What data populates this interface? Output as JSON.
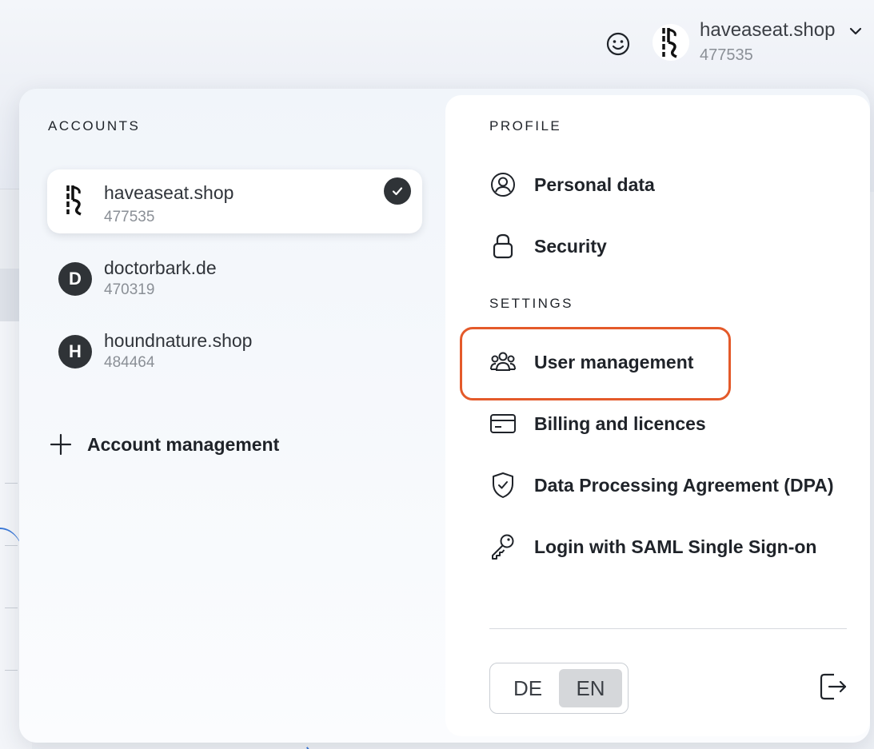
{
  "header": {
    "account_name": "haveaseat.shop",
    "account_id": "477535"
  },
  "accounts_panel": {
    "heading": "ACCOUNTS",
    "accounts": [
      {
        "name": "haveaseat.shop",
        "id": "477535",
        "avatar": "logo",
        "selected": true
      },
      {
        "name": "doctorbark.de",
        "id": "470319",
        "avatar": "D",
        "selected": false
      },
      {
        "name": "houndnature.shop",
        "id": "484464",
        "avatar": "H",
        "selected": false
      }
    ],
    "account_management_label": "Account management"
  },
  "profile_panel": {
    "profile_heading": "PROFILE",
    "profile_items": [
      {
        "label": "Personal data",
        "icon": "user-circle-icon"
      },
      {
        "label": "Security",
        "icon": "lock-icon"
      }
    ],
    "settings_heading": "SETTINGS",
    "settings_items": [
      {
        "label": "User management",
        "icon": "users-group-icon",
        "highlighted": true
      },
      {
        "label": "Billing and licences",
        "icon": "credit-card-icon"
      },
      {
        "label": "Data Processing Agreement (DPA)",
        "icon": "shield-check-icon"
      },
      {
        "label": "Login with SAML Single Sign-on",
        "icon": "key-icon"
      }
    ],
    "language": {
      "options": [
        "DE",
        "EN"
      ],
      "selected": "EN"
    }
  },
  "colors": {
    "highlight_border": "#e45a2a",
    "avatar_dark": "#2f3337",
    "selected_language_bg": "#d5d7da"
  }
}
